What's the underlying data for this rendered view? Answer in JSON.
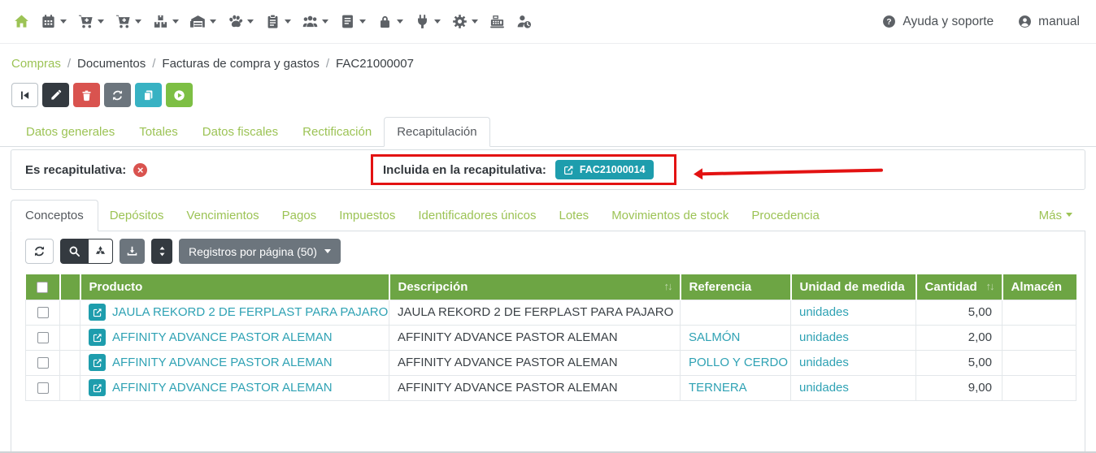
{
  "colors": {
    "brand_green": "#9cc355",
    "header_green": "#6da544",
    "teal_link": "#2fa2b4",
    "teal_badge": "#1e9dad",
    "teal_btn": "#38b2c3",
    "dark_btn": "#343a40",
    "gray_btn": "#6c757d",
    "red_btn": "#d9534f",
    "green_btn": "#7dbf44",
    "annotation_red": "#e31212",
    "icon_gray": "#5d6166",
    "border_gray": "#d9dee2",
    "text_dark": "#3c4247"
  },
  "topbar": {
    "menu_icons": [
      {
        "name": "home-icon",
        "caret": false,
        "accent": true
      },
      {
        "name": "calendar-icon",
        "caret": true
      },
      {
        "name": "cart-icon",
        "caret": true
      },
      {
        "name": "cart2-icon",
        "caret": true
      },
      {
        "name": "boxes-icon",
        "caret": true
      },
      {
        "name": "warehouse-icon",
        "caret": true
      },
      {
        "name": "paw-icon",
        "caret": true
      },
      {
        "name": "clipboard-icon",
        "caret": true
      },
      {
        "name": "users-icon",
        "caret": true
      },
      {
        "name": "journal-icon",
        "caret": true
      },
      {
        "name": "lock-icon",
        "caret": true
      },
      {
        "name": "plug-icon",
        "caret": true
      },
      {
        "name": "gear-icon",
        "caret": true
      },
      {
        "name": "cash-register-icon",
        "caret": false
      },
      {
        "name": "user-clock-icon",
        "caret": false
      }
    ],
    "help_label": "Ayuda y soporte",
    "user_label": "manual"
  },
  "breadcrumb": {
    "items": [
      {
        "label": "Compras",
        "link": true
      },
      {
        "label": "Documentos",
        "link": false
      },
      {
        "label": "Facturas de compra y gastos",
        "link": false
      },
      {
        "label": "FAC21000007",
        "link": false
      }
    ]
  },
  "action_buttons": [
    {
      "name": "first-record-button",
      "icon": "skip-start",
      "style": "light"
    },
    {
      "name": "edit-button",
      "icon": "pencil",
      "style": "dark"
    },
    {
      "name": "delete-button",
      "icon": "trash",
      "style": "red"
    },
    {
      "name": "refresh-button",
      "icon": "refresh",
      "style": "gray"
    },
    {
      "name": "duplicate-button",
      "icon": "copy",
      "style": "teal"
    },
    {
      "name": "process-button",
      "icon": "play",
      "style": "green"
    }
  ],
  "main_tabs": {
    "items": [
      "Datos generales",
      "Totales",
      "Datos fiscales",
      "Rectificación",
      "Recapitulación"
    ],
    "active": "Recapitulación"
  },
  "recap": {
    "es_label": "Es recapitulativa:",
    "incluida_label": "Incluida en la recapitulativa:",
    "badge": "FAC21000014"
  },
  "sub_tabs": {
    "items": [
      "Conceptos",
      "Depósitos",
      "Vencimientos",
      "Pagos",
      "Impuestos",
      "Identificadores únicos",
      "Lotes",
      "Movimientos de stock",
      "Procedencia"
    ],
    "active": "Conceptos",
    "more_label": "Más"
  },
  "toolbar": {
    "records_per_page_label": "Registros por página (50)"
  },
  "table": {
    "columns": [
      "Producto",
      "Descripción",
      "Referencia",
      "Unidad de medida",
      "Cantidad",
      "Almacén"
    ],
    "sortable_columns": [
      "Descripción",
      "Cantidad"
    ],
    "rows": [
      {
        "product": "JAULA REKORD 2 DE FERPLAST PARA PAJARO",
        "description": "JAULA REKORD 2 DE FERPLAST PARA PAJARO",
        "reference": "",
        "unit": "unidades",
        "quantity": "5,00",
        "warehouse": ""
      },
      {
        "product": "AFFINITY ADVANCE PASTOR ALEMAN",
        "description": "AFFINITY ADVANCE PASTOR ALEMAN",
        "reference": "SALMÓN",
        "unit": "unidades",
        "quantity": "2,00",
        "warehouse": ""
      },
      {
        "product": "AFFINITY ADVANCE PASTOR ALEMAN",
        "description": "AFFINITY ADVANCE PASTOR ALEMAN",
        "reference": "POLLO Y CERDO",
        "unit": "unidades",
        "quantity": "5,00",
        "warehouse": ""
      },
      {
        "product": "AFFINITY ADVANCE PASTOR ALEMAN",
        "description": "AFFINITY ADVANCE PASTOR ALEMAN",
        "reference": "TERNERA",
        "unit": "unidades",
        "quantity": "9,00",
        "warehouse": ""
      }
    ]
  }
}
